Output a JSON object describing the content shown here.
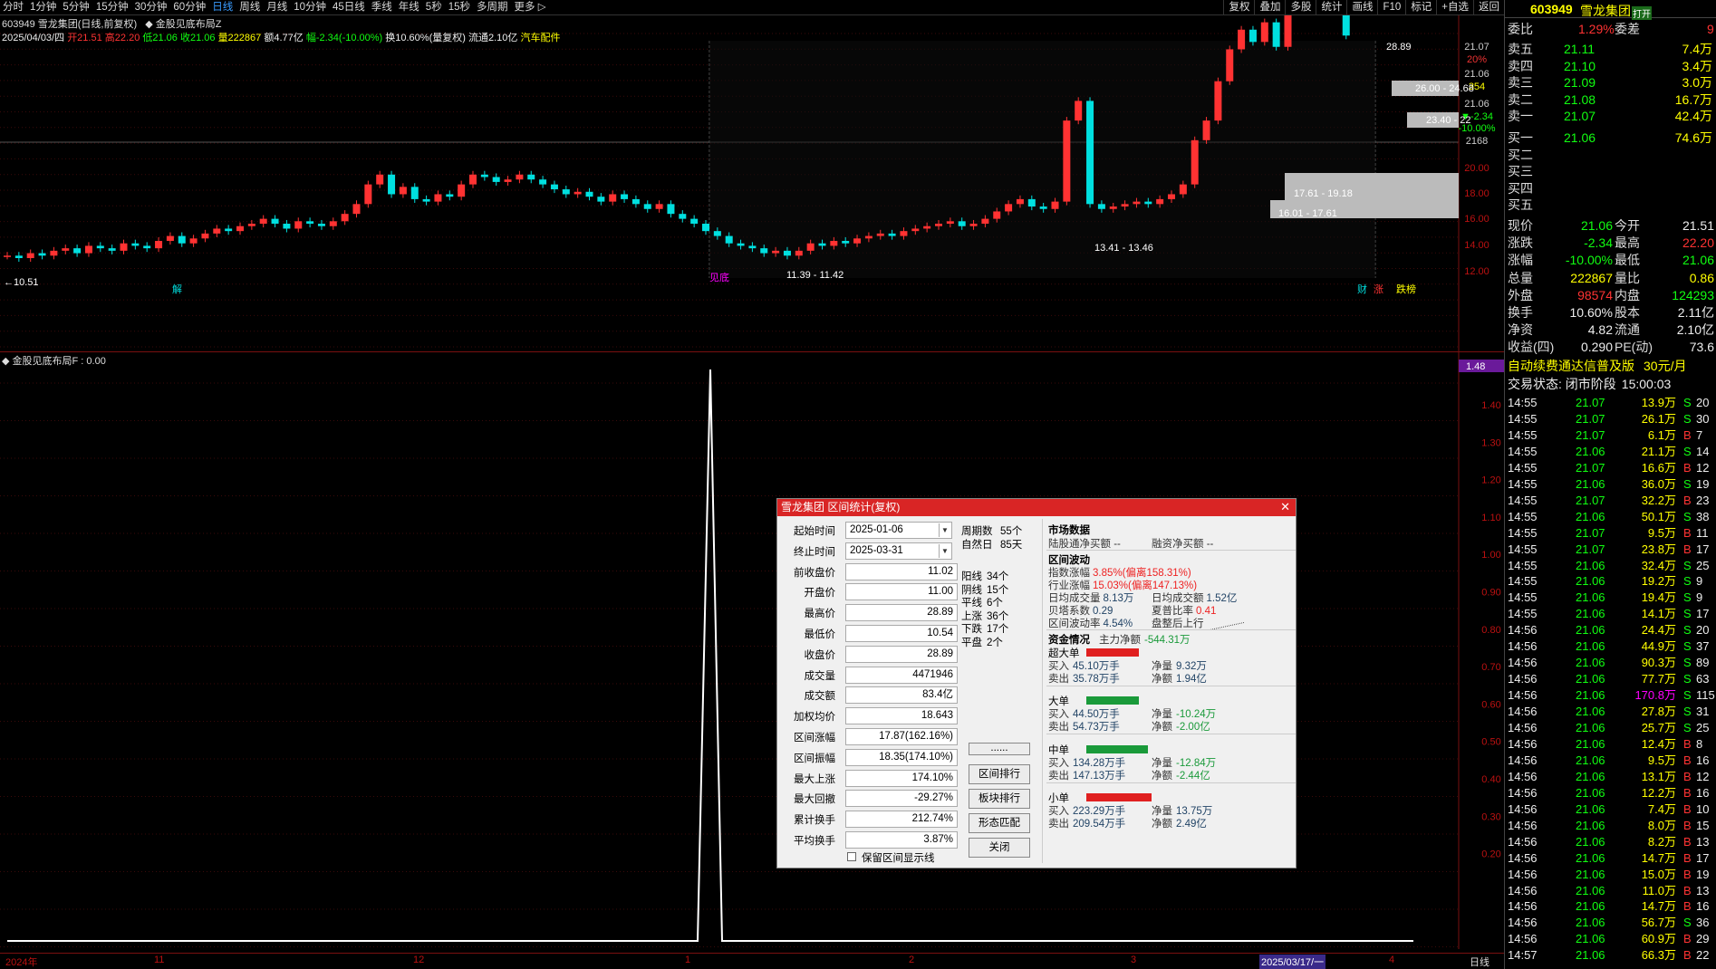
{
  "toolbar": {
    "periods": [
      "分时",
      "1分钟",
      "5分钟",
      "15分钟",
      "30分钟",
      "60分钟",
      "日线",
      "周线",
      "月线",
      "10分钟",
      "45日线",
      "季线",
      "年线",
      "5秒",
      "15秒",
      "多周期",
      "更多 ▷"
    ],
    "active": "日线",
    "right": [
      "复权",
      "叠加",
      "多股",
      "统计",
      "画线",
      "F10",
      "标记",
      "+自选",
      "返回"
    ]
  },
  "header": {
    "name_line": "603949 雪龙集团(日线,前复权)",
    "indicator_line": "◆ 金股见底布局Z",
    "date": "2025/04/03/四",
    "open": "开21.51",
    "high": "高22.20",
    "low": "低21.06",
    "close": "收21.06",
    "volume": "量222867",
    "amount": "额4.77亿",
    "change": "幅-2.34(-10.00%)",
    "turnover": "换10.60%(量复权)",
    "float": "流通2.10亿",
    "sector": "汽车配件"
  },
  "chart": {
    "y_ticks": [
      "21.07",
      "20%",
      "21.06",
      "354",
      "21.06",
      "▼-2.34",
      "-10.00%",
      "2168",
      "20.00",
      "18.00",
      "16.00",
      "14.00",
      "12.00"
    ],
    "range_labels": [
      "26.00 - 24.68",
      "23.40 - 22",
      "17.61 - 19.18",
      "16.01 - 17.61",
      "13.41 - 13.46",
      "11.39 - 11.42"
    ],
    "high_label": "28.89",
    "low_label": "←10.51",
    "markers": {
      "jie": "解",
      "jiandi": "见底",
      "cai": "财",
      "zhang": "涨",
      "die": "跌榜"
    }
  },
  "sub": {
    "title": "◆ 金股见底布局F : 0.00",
    "axis": [
      "1.40",
      "1.30",
      "1.20",
      "1.10",
      "1.00",
      "0.90",
      "0.80",
      "0.70",
      "0.60",
      "0.50",
      "0.40",
      "0.30",
      "0.20"
    ],
    "top_value": "1.48"
  },
  "xaxis": {
    "labels": [
      "2024年",
      "11",
      "12",
      "1",
      "2",
      "3",
      "2025/03/17/一",
      "4"
    ],
    "period": "日线"
  },
  "panel": {
    "code": "603949",
    "name": "雪龙集团",
    "badge": "打开",
    "wb_label": "委比",
    "wb_value": "1.29%",
    "wc_label": "委差",
    "wc_value": "9",
    "asks": [
      {
        "label": "卖五",
        "price": "21.11",
        "vol": "7.4万"
      },
      {
        "label": "卖四",
        "price": "21.10",
        "vol": "3.4万"
      },
      {
        "label": "卖三",
        "price": "21.09",
        "vol": "3.0万"
      },
      {
        "label": "卖二",
        "price": "21.08",
        "vol": "16.7万"
      },
      {
        "label": "卖一",
        "price": "21.07",
        "vol": "42.4万"
      }
    ],
    "bids": [
      {
        "label": "买一",
        "price": "21.06",
        "vol": "74.6万"
      },
      {
        "label": "买二",
        "price": "",
        "vol": ""
      },
      {
        "label": "买三",
        "price": "",
        "vol": ""
      },
      {
        "label": "买四",
        "price": "",
        "vol": ""
      },
      {
        "label": "买五",
        "price": "",
        "vol": ""
      }
    ],
    "stats": [
      [
        "现价",
        "21.06",
        "今开",
        "21.51"
      ],
      [
        "涨跌",
        "-2.34",
        "最高",
        "22.20"
      ],
      [
        "涨幅",
        "-10.00%",
        "最低",
        "21.06"
      ],
      [
        "总量",
        "222867",
        "量比",
        "0.86"
      ],
      [
        "外盘",
        "98574",
        "内盘",
        "124293"
      ],
      [
        "换手",
        "10.60%",
        "股本",
        "2.11亿"
      ],
      [
        "净资",
        "4.82",
        "流通",
        "2.10亿"
      ],
      [
        "收益(四)",
        "0.290",
        "PE(动)",
        "73.6"
      ]
    ],
    "ad": "自动续费通达信普及版",
    "ad_price": "30元/月",
    "status": "交易状态: 闭市阶段",
    "status_time": "15:00:03",
    "ticks": [
      [
        "14:55",
        "21.07",
        "13.9万",
        "S",
        "20"
      ],
      [
        "14:55",
        "21.07",
        "26.1万",
        "S",
        "30"
      ],
      [
        "14:55",
        "21.07",
        "6.1万",
        "B",
        "7"
      ],
      [
        "14:55",
        "21.06",
        "21.1万",
        "S",
        "14"
      ],
      [
        "14:55",
        "21.07",
        "16.6万",
        "B",
        "12"
      ],
      [
        "14:55",
        "21.06",
        "36.0万",
        "S",
        "19"
      ],
      [
        "14:55",
        "21.07",
        "32.2万",
        "B",
        "23"
      ],
      [
        "14:55",
        "21.06",
        "50.1万",
        "S",
        "38"
      ],
      [
        "14:55",
        "21.07",
        "9.5万",
        "B",
        "11"
      ],
      [
        "14:55",
        "21.07",
        "23.8万",
        "B",
        "17"
      ],
      [
        "14:55",
        "21.06",
        "32.4万",
        "S",
        "25"
      ],
      [
        "14:55",
        "21.06",
        "19.2万",
        "S",
        "9"
      ],
      [
        "14:55",
        "21.06",
        "19.4万",
        "S",
        "9"
      ],
      [
        "14:55",
        "21.06",
        "14.1万",
        "S",
        "17"
      ],
      [
        "14:56",
        "21.06",
        "24.4万",
        "S",
        "20"
      ],
      [
        "14:56",
        "21.06",
        "44.9万",
        "S",
        "37"
      ],
      [
        "14:56",
        "21.06",
        "90.3万",
        "S",
        "89"
      ],
      [
        "14:56",
        "21.06",
        "77.7万",
        "S",
        "63"
      ],
      [
        "14:56",
        "21.06",
        "170.8万",
        "S",
        "115"
      ],
      [
        "14:56",
        "21.06",
        "27.8万",
        "S",
        "31"
      ],
      [
        "14:56",
        "21.06",
        "25.7万",
        "S",
        "25"
      ],
      [
        "14:56",
        "21.06",
        "12.4万",
        "B",
        "8"
      ],
      [
        "14:56",
        "21.06",
        "9.5万",
        "B",
        "16"
      ],
      [
        "14:56",
        "21.06",
        "13.1万",
        "B",
        "12"
      ],
      [
        "14:56",
        "21.06",
        "12.2万",
        "B",
        "16"
      ],
      [
        "14:56",
        "21.06",
        "7.4万",
        "B",
        "10"
      ],
      [
        "14:56",
        "21.06",
        "8.0万",
        "B",
        "15"
      ],
      [
        "14:56",
        "21.06",
        "8.2万",
        "B",
        "13"
      ],
      [
        "14:56",
        "21.06",
        "14.7万",
        "B",
        "17"
      ],
      [
        "14:56",
        "21.06",
        "15.0万",
        "B",
        "19"
      ],
      [
        "14:56",
        "21.06",
        "11.0万",
        "B",
        "13"
      ],
      [
        "14:56",
        "21.06",
        "14.7万",
        "B",
        "16"
      ],
      [
        "14:56",
        "21.06",
        "56.7万",
        "S",
        "36"
      ],
      [
        "14:56",
        "21.06",
        "60.9万",
        "B",
        "29"
      ],
      [
        "14:57",
        "21.06",
        "66.3万",
        "B",
        "22"
      ]
    ]
  },
  "dialog": {
    "title": "雪龙集团 区间统计(复权)",
    "close": "✕",
    "fields": [
      [
        "起始时间",
        "2025-01-06"
      ],
      [
        "终止时间",
        "2025-03-31"
      ],
      [
        "前收盘价",
        "11.02"
      ],
      [
        "开盘价",
        "11.00"
      ],
      [
        "最高价",
        "28.89"
      ],
      [
        "最低价",
        "10.54"
      ],
      [
        "收盘价",
        "28.89"
      ],
      [
        "成交量",
        "4471946"
      ],
      [
        "成交额",
        "83.4亿"
      ],
      [
        "加权均价",
        "18.643"
      ],
      [
        "区间涨幅",
        "17.87(162.16%)"
      ],
      [
        "区间振幅",
        "18.35(174.10%)"
      ],
      [
        "最大上涨",
        "174.10%"
      ],
      [
        "最大回撤",
        "-29.27%"
      ],
      [
        "累计换手",
        "212.74%"
      ],
      [
        "平均换手",
        "3.87%"
      ]
    ],
    "checkbox": "保留区间显示线",
    "stats1": [
      [
        "周期数",
        "55个"
      ],
      [
        "自然日",
        "85天"
      ]
    ],
    "stats2": [
      [
        "阳线",
        "34个"
      ],
      [
        "阴线",
        "15个"
      ],
      [
        "平线",
        "6个"
      ],
      [
        "上涨",
        "36个"
      ],
      [
        "下跌",
        "17个"
      ],
      [
        "平盘",
        "2个"
      ]
    ],
    "buttons": [
      "......",
      "区间排行",
      "板块排行",
      "形态匹配",
      "关闭"
    ],
    "market": {
      "title": "市场数据",
      "hk_in": "陆股通净买额 --",
      "rz": "融资净买额 --"
    },
    "vol": {
      "title": "区间波动",
      "idx": "指数涨幅",
      "idx_v": "3.85%",
      "idx_d": "(偏离158.31%)",
      "ind": "行业涨幅",
      "ind_v": "15.03%",
      "ind_d": "(偏离147.13%)",
      "d_vol": "日均成交量",
      "d_vol_v": "8.13万",
      "d_amt": "日均成交额",
      "d_amt_v": "1.52亿",
      "beta": "贝塔系数",
      "beta_v": "0.29",
      "sharpe": "夏普比率",
      "sharpe_v": "0.41",
      "wave": "区间波动率",
      "wave_v": "4.54%",
      "trend": "盘整后上行"
    },
    "fund": {
      "title": "资金情况",
      "main": "主力净额",
      "main_v": "-544.31万",
      "groups": [
        {
          "name": "超大单",
          "buy": "45.10万手",
          "sell": "35.78万手",
          "net": "9.32万",
          "amt": "1.94亿",
          "color": "#e02020",
          "neg": false
        },
        {
          "name": "大单",
          "buy": "44.50万手",
          "sell": "54.73万手",
          "net": "-10.24万",
          "amt": "-2.00亿",
          "color": "#1a9a3a",
          "neg": true
        },
        {
          "name": "中单",
          "buy": "134.28万手",
          "sell": "147.13万手",
          "net": "-12.84万",
          "amt": "-2.44亿",
          "color": "#1a9a3a",
          "neg": true
        },
        {
          "name": "小单",
          "buy": "223.29万手",
          "sell": "209.54万手",
          "net": "13.75万",
          "amt": "2.49亿",
          "color": "#e02020",
          "neg": false
        }
      ],
      "buy_l": "买入",
      "sell_l": "卖出",
      "net_l": "净量",
      "amt_l": "净额"
    }
  }
}
